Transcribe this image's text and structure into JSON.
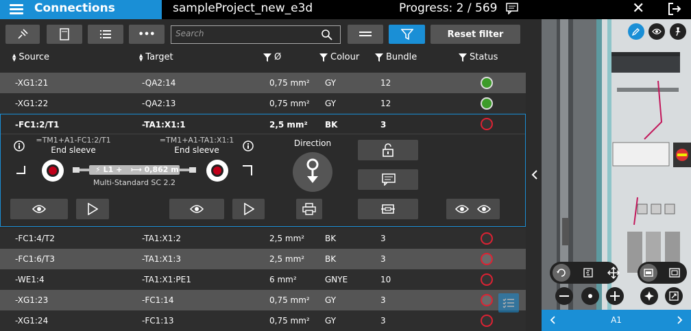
{
  "topbar": {
    "title": "Connections",
    "project": "sampleProject_new_e3d",
    "progress": "Progress: 2 / 569"
  },
  "toolbar": {
    "more_label": "•••",
    "search_placeholder": "Search",
    "reset_filter_label": "Reset filter"
  },
  "columns": {
    "source": "Source",
    "target": "Target",
    "diameter": "Ø",
    "colour": "Colour",
    "bundle": "Bundle",
    "status": "Status"
  },
  "rows_top": [
    {
      "source": "-XG1:21",
      "target": "-QA2:14",
      "diameter": "0,75 mm²",
      "colour": "GY",
      "bundle": "12",
      "status": "done"
    },
    {
      "source": "-XG1:22",
      "target": "-QA2:13",
      "diameter": "0,75 mm²",
      "colour": "GY",
      "bundle": "12",
      "status": "done"
    }
  ],
  "selected": {
    "source": "-FC1:2/T1",
    "target": "-TA1:X1:1",
    "diameter": "2,5 mm²",
    "colour": "BK",
    "bundle": "3",
    "left_ref": "=TM1+A1-FC1:2/T1",
    "left_end": "End sleeve",
    "right_ref": "=TM1+A1-TA1:X1:1",
    "right_end": "End sleeve",
    "cable_label": "L1",
    "cable_length": "0,862 m",
    "cable_type": "Multi-Standard SC 2.2",
    "direction_label": "Direction"
  },
  "rows_bottom": [
    {
      "source": "-FC1:4/T2",
      "target": "-TA1:X1:2",
      "diameter": "2,5 mm²",
      "colour": "BK",
      "bundle": "3",
      "status": "open"
    },
    {
      "source": "-FC1:6/T3",
      "target": "-TA1:X1:3",
      "diameter": "2,5 mm²",
      "colour": "BK",
      "bundle": "3",
      "status": "open"
    },
    {
      "source": "-WE1:4",
      "target": "-TA1:X1:PE1",
      "diameter": "6 mm²",
      "colour": "GNYE",
      "bundle": "10",
      "status": "open"
    },
    {
      "source": "-XG1:23",
      "target": "-FC1:14",
      "diameter": "0,75 mm²",
      "colour": "GY",
      "bundle": "3",
      "status": "open"
    },
    {
      "source": "-XG1:24",
      "target": "-FC1:13",
      "diameter": "0,75 mm²",
      "colour": "GY",
      "bundle": "3",
      "status": "open"
    }
  ],
  "viewer": {
    "page_label": "A1"
  },
  "colors": {
    "accent": "#1a8fd6",
    "status_done": "#3d9b2a",
    "status_open": "#d22233"
  }
}
